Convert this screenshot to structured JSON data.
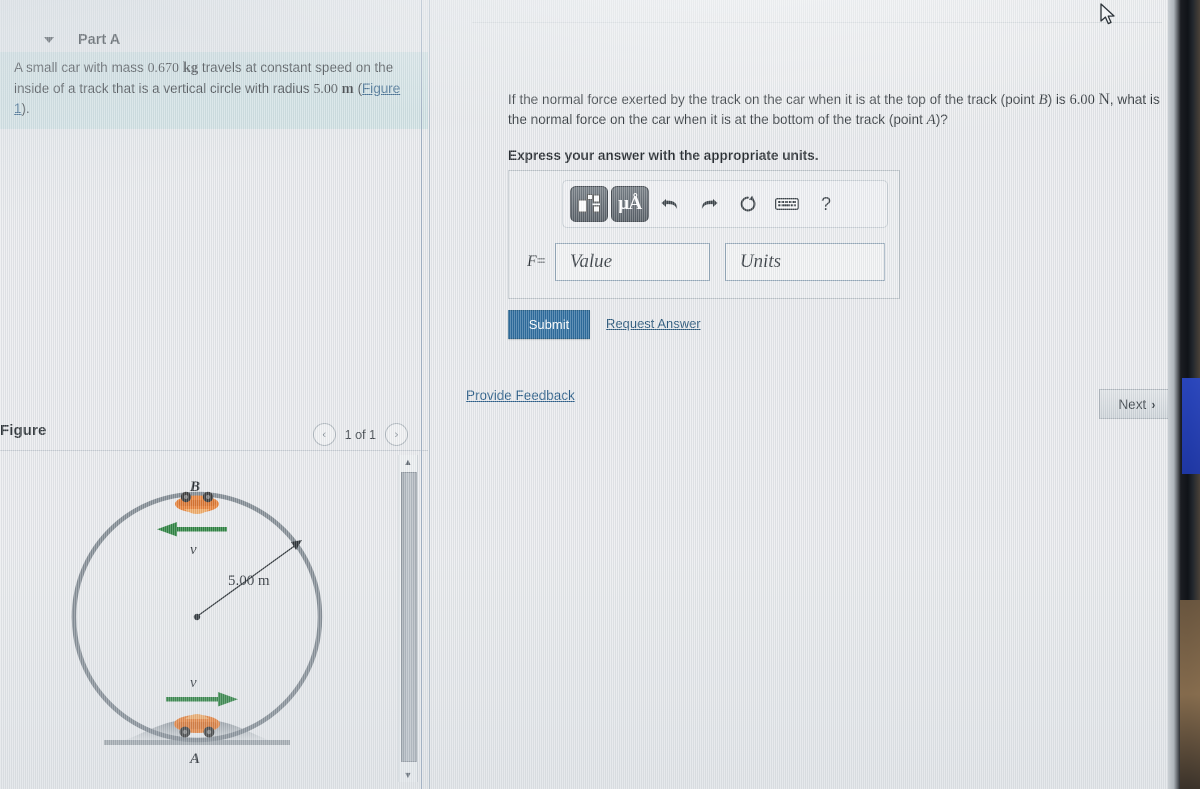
{
  "problem": {
    "text_before_mass": "A small car with mass ",
    "mass_value": "0.670",
    "mass_unit": "kg",
    "text_mid": " travels at constant speed on the inside of a track that is a vertical circle with radius ",
    "radius_value": "5.00",
    "radius_unit": "m",
    "figure_link": "Figure 1",
    "trailing": ")."
  },
  "partA": {
    "title": "Part A",
    "caret_icon": "triangle-down-icon",
    "question_line1": "If the normal force exerted by the track on the car when it is at the top of the track (point ",
    "point_top": "B",
    "question_line1b": ") is ",
    "given_value": "6.00",
    "given_unit": "N",
    "question_line2": ", what is the normal force on the car when it is at the bottom of the track (point ",
    "point_bottom": "A",
    "question_line2b": ")?",
    "instruction": "Express your answer with the appropriate units."
  },
  "answer": {
    "label": "F",
    "equals": "=",
    "value": "",
    "value_placeholder": "Value",
    "units": "",
    "units_placeholder": "Units",
    "toolbar": [
      {
        "name": "math-template-icon",
        "title": "Math templates"
      },
      {
        "name": "units-micro-angstrom-icon",
        "title": "μÅ",
        "label": "μÅ"
      },
      {
        "name": "undo-icon",
        "title": "Undo"
      },
      {
        "name": "redo-icon",
        "title": "Redo"
      },
      {
        "name": "reset-icon",
        "title": "Reset"
      },
      {
        "name": "keyboard-icon",
        "title": "Keyboard shortcuts"
      },
      {
        "name": "help-icon",
        "title": "Help",
        "label": "?"
      }
    ]
  },
  "actions": {
    "submit": "Submit",
    "request_answer": "Request Answer",
    "provide_feedback": "Provide Feedback",
    "next": "Next",
    "next_chevron": "›"
  },
  "figure": {
    "title": "Figure",
    "pager_prev": "‹",
    "pager_next": "›",
    "pager_label": "1 of 1",
    "labels": {
      "top_point": "B",
      "bottom_point": "A",
      "velocity_top": "v",
      "velocity_bottom": "v",
      "radius": "5.00 m"
    },
    "colors": {
      "track": "#7b848c",
      "velocity_arrow": "#1f7a33",
      "car_body": "#e8792a",
      "ground": "#8a9299"
    }
  },
  "scrollbar": {
    "up_arrow": "▲",
    "down_arrow": "▼"
  },
  "cursor": {
    "name": "mouse-pointer-icon"
  }
}
